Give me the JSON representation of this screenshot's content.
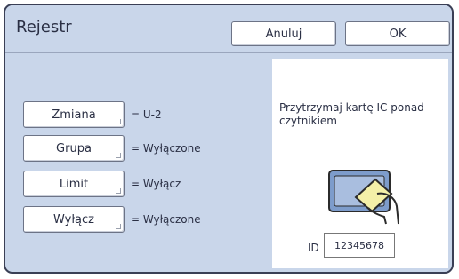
{
  "dialog": {
    "title": "Rejestr",
    "cancel_label": "Anuluj",
    "ok_label": "OK"
  },
  "settings": [
    {
      "button": "Zmiana",
      "value": "= U-2"
    },
    {
      "button": "Grupa",
      "value": "= Wyłączone"
    },
    {
      "button": "Limit",
      "value": "= Wyłącz"
    },
    {
      "button": "Wyłącz",
      "value": "= Wyłączone"
    }
  ],
  "card_panel": {
    "instruction": "Przytrzymaj kartę IC ponad czytnikiem",
    "id_label": "ID",
    "id_value": "12345678",
    "icon": "card-reader-icon"
  },
  "colors": {
    "background": "#c9d6ea",
    "border": "#3a3f55",
    "reader_fill": "#7d9ccb",
    "card_fill": "#f4f0a8"
  }
}
